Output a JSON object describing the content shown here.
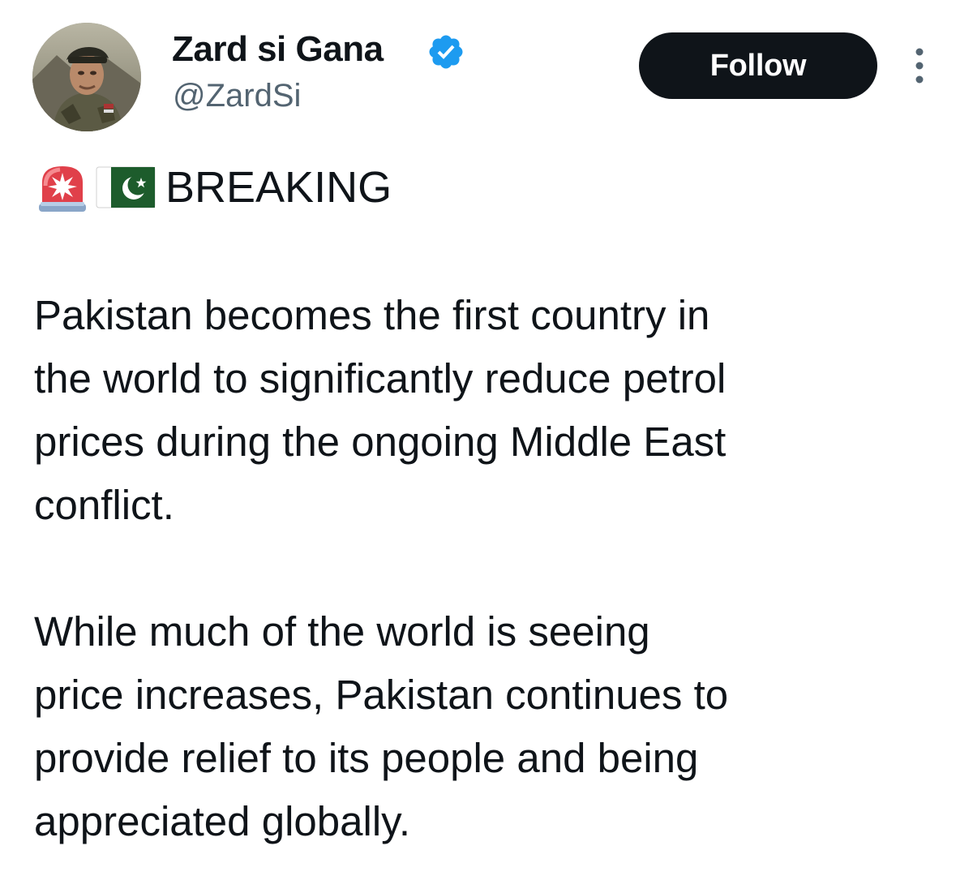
{
  "author": {
    "display_name": "Zard si Gana",
    "handle": "@ZardSi",
    "avatar": "profile-photo",
    "verified": true,
    "verified_color": "#1d9bf0"
  },
  "actions": {
    "follow_label": "Follow",
    "more_icon": "more-vertical-icon"
  },
  "tweet": {
    "header_icons": [
      "siren-icon",
      "pakistan-flag-icon"
    ],
    "headline": "BREAKING",
    "paragraphs": [
      {
        "lines": [
          "Pakistan becomes the first country in",
          "the world to significantly reduce petrol",
          "prices during the ongoing Middle East",
          "conflict."
        ]
      },
      {
        "lines": [
          "While much of the world is seeing",
          "price increases, Pakistan continues to",
          "provide relief to its people and being",
          "appreciated globally."
        ]
      }
    ]
  },
  "colors": {
    "text": "#0f1419",
    "secondary_text": "#536471",
    "button_bg": "#0f1419",
    "button_text": "#ffffff"
  }
}
